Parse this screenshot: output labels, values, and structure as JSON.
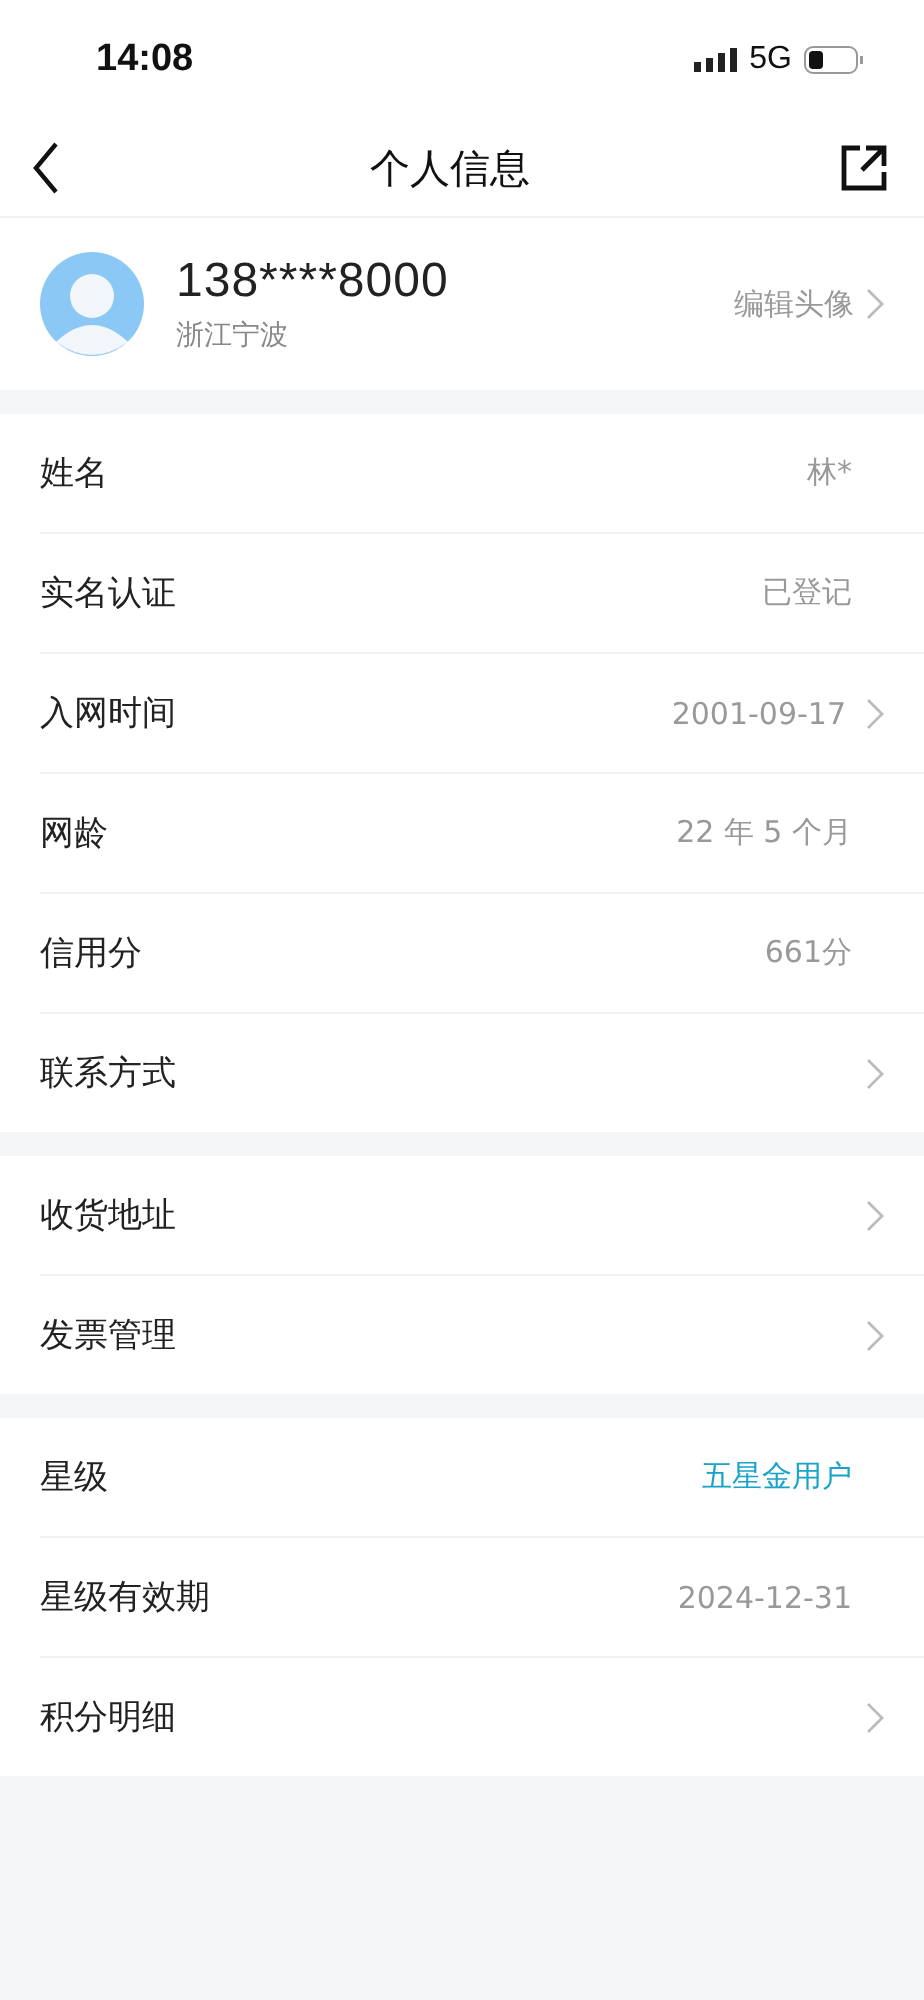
{
  "status_bar": {
    "time": "14:08",
    "network": "5G"
  },
  "nav": {
    "title": "个人信息"
  },
  "profile": {
    "phone": "138****8000",
    "location": "浙江宁波",
    "action": "编辑头像"
  },
  "groups": [
    {
      "rows": [
        {
          "label": "姓名",
          "value": "林*",
          "kind": "plain",
          "arrow": false
        },
        {
          "label": "实名认证",
          "value": "已登记",
          "kind": "plain",
          "arrow": false
        },
        {
          "label": "入网时间",
          "value": "2001-09-17",
          "kind": "plain",
          "arrow": true
        },
        {
          "label": "网龄",
          "value": "22 年 5 个月",
          "kind": "plain",
          "arrow": false
        },
        {
          "label": "信用分",
          "value": "661分",
          "kind": "plain",
          "arrow": false
        },
        {
          "label": "联系方式",
          "arrow": true
        }
      ]
    },
    {
      "rows": [
        {
          "label": "收货地址",
          "arrow": true
        },
        {
          "label": "发票管理",
          "arrow": true
        }
      ]
    },
    {
      "rows": [
        {
          "label": "星级",
          "value": "五星金用户",
          "kind": "highlight",
          "arrow": false
        },
        {
          "label": "星级有效期",
          "value": "2024-12-31",
          "kind": "plain",
          "arrow": false
        },
        {
          "label": "积分明细",
          "arrow": true
        }
      ]
    }
  ]
}
